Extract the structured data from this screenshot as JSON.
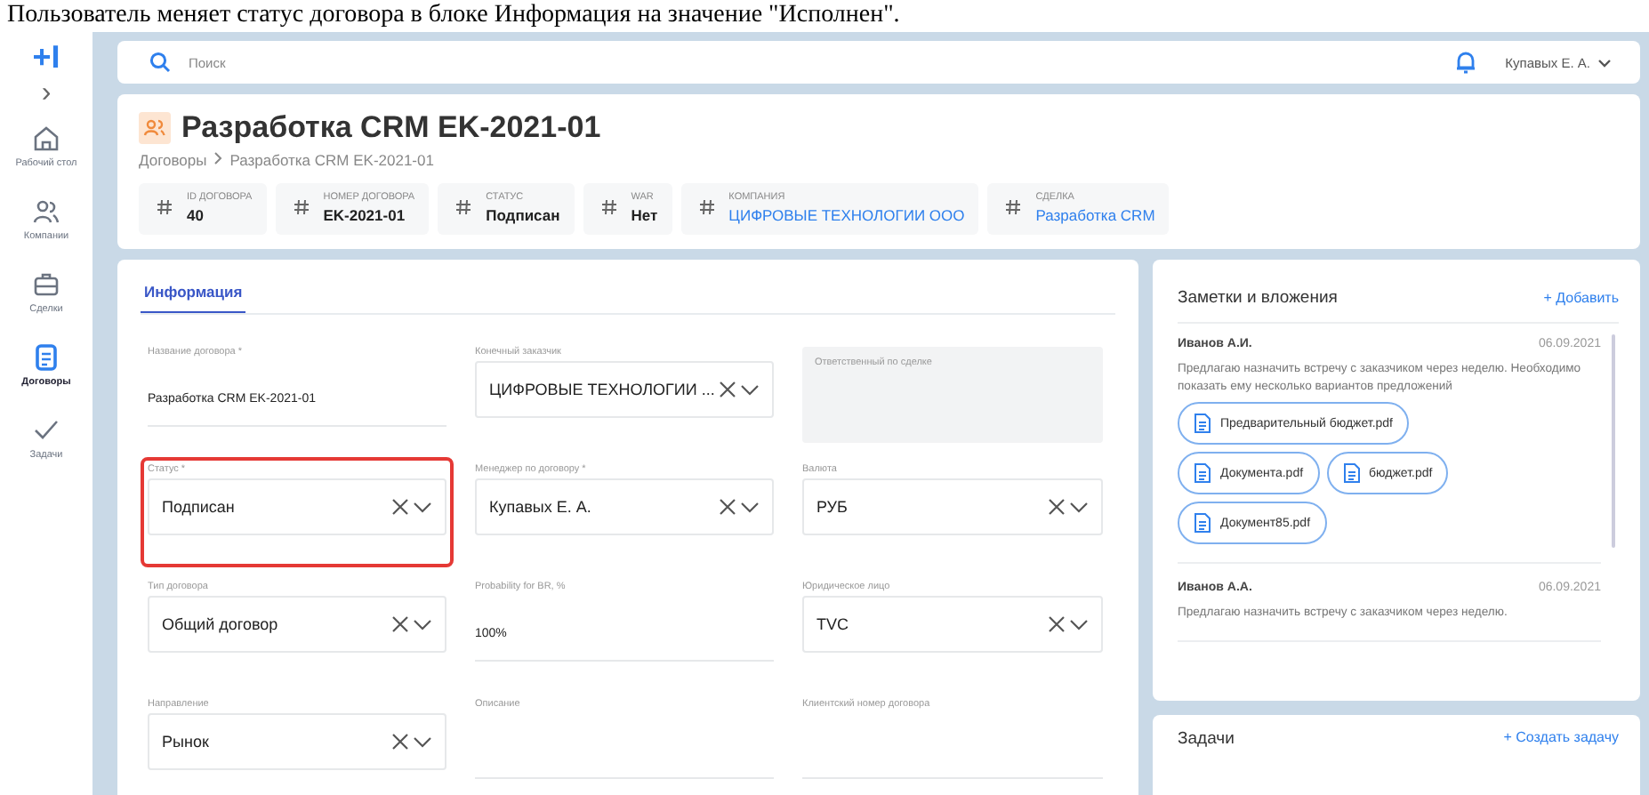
{
  "caption": "Пользователь меняет статус договора в блоке Информация на значение \"Исполнен\".",
  "sidebar": {
    "logo": "+I",
    "expand": "›",
    "items": [
      {
        "label": "Рабочий стол",
        "selected": false
      },
      {
        "label": "Компании",
        "selected": false
      },
      {
        "label": "Сделки",
        "selected": false
      },
      {
        "label": "Договоры",
        "selected": true
      },
      {
        "label": "Задачи",
        "selected": false
      }
    ]
  },
  "topbar": {
    "search": {
      "placeholder": "Поиск"
    },
    "user": "Купавых Е. А."
  },
  "header": {
    "title": "Разработка CRM EK-2021-01",
    "breadcrumbs": [
      "Договоры",
      "Разработка CRM EK-2021-01"
    ],
    "facts": [
      {
        "label": "ID ДОГОВОРА",
        "value": "40",
        "link": false
      },
      {
        "label": "НОМЕР ДОГОВОРА",
        "value": "EK-2021-01",
        "link": false
      },
      {
        "label": "СТАТУС",
        "value": "Подписан",
        "link": false
      },
      {
        "label": "WAR",
        "value": "Нет",
        "link": false
      },
      {
        "label": "КОМПАНИЯ",
        "value": "ЦИФРОВЫЕ ТЕХНОЛОГИИ ООО",
        "link": true
      },
      {
        "label": "СДЕЛКА",
        "value": "Разработка CRM",
        "link": true
      }
    ]
  },
  "tabs": [
    {
      "label": "Информация",
      "selected": true
    }
  ],
  "fields": [
    {
      "kind": "text",
      "label": "Название договора *",
      "value": "Разработка CRM EK-2021-01",
      "highlighted": false
    },
    {
      "kind": "select",
      "label": "Конечный заказчик",
      "value": "ЦИФРОВЫЕ ТЕХНОЛОГИИ ...",
      "highlighted": false
    },
    {
      "kind": "disabled",
      "label": "Ответственный по сделке",
      "highlighted": false
    },
    {
      "kind": "select",
      "label": "Статус *",
      "value": "Подписан",
      "highlighted": true
    },
    {
      "kind": "select",
      "label": "Менеджер по договору *",
      "value": "Купавых Е. А.",
      "highlighted": false
    },
    {
      "kind": "select",
      "label": "Валюта",
      "value": "РУБ",
      "highlighted": false
    },
    {
      "kind": "select",
      "label": "Тип договора",
      "value": "Общий договор",
      "highlighted": false
    },
    {
      "kind": "text",
      "label": "Probability for BR, %",
      "value": "100%",
      "highlighted": false
    },
    {
      "kind": "select",
      "label": "Юридическое лицо",
      "value": "TVC",
      "highlighted": false
    },
    {
      "kind": "select",
      "label": "Направление",
      "value": "Рынок",
      "highlighted": false
    },
    {
      "kind": "text",
      "label": "Описание",
      "highlighted": false
    },
    {
      "kind": "text",
      "label": "Клиентский номер договора",
      "highlighted": false
    }
  ],
  "notes": {
    "title": "Заметки и вложения",
    "add": "+ Добавить",
    "items": [
      {
        "author": "Иванов А.И.",
        "date": "06.09.2021",
        "text": "Предлагаю назначить встречу с заказчиком через неделю. Необходимо показать ему несколько вариантов предложений",
        "files": [
          "Предварительный бюджет.pdf",
          "Документа.pdf",
          "бюджет.pdf",
          "Документ85.pdf"
        ]
      },
      {
        "author": "Иванов А.А.",
        "date": "06.09.2021",
        "text": "Предлагаю назначить встречу с заказчиком через неделю."
      }
    ]
  },
  "tasks": {
    "title": "Задачи",
    "add": "+ Создать задачу"
  }
}
